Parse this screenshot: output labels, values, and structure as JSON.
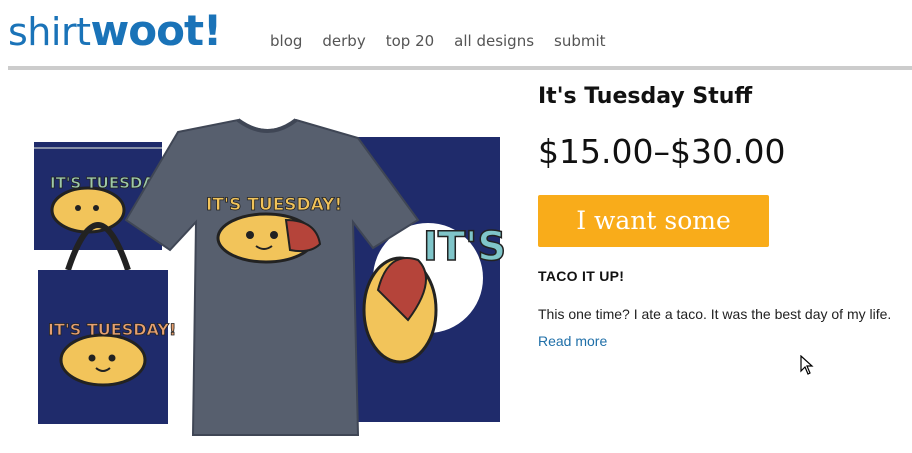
{
  "logo": {
    "part1": "shirt",
    "part2": "woot!"
  },
  "nav": {
    "items": [
      {
        "label": "blog"
      },
      {
        "label": "derby"
      },
      {
        "label": "top 20"
      },
      {
        "label": "all designs"
      },
      {
        "label": "submit"
      }
    ]
  },
  "product": {
    "title": "It's Tuesday Stuff",
    "price": "$15.00–$30.00",
    "cta_label": "I want some",
    "tagline": "TACO IT UP!",
    "description": "This one time? I ate a taco. It was the best day of my life.",
    "read_more": "Read more",
    "image": {
      "artwork_text": "IT'S TUESDAY!",
      "colors": {
        "navy": "#1f2b6b",
        "heather": "#575f6e",
        "taco": "#f2c45a"
      }
    }
  },
  "colors": {
    "brand_blue": "#1a73b8",
    "cta_orange": "#f9ac1a",
    "link_blue": "#1f6fa8",
    "divider": "#cccccc"
  }
}
